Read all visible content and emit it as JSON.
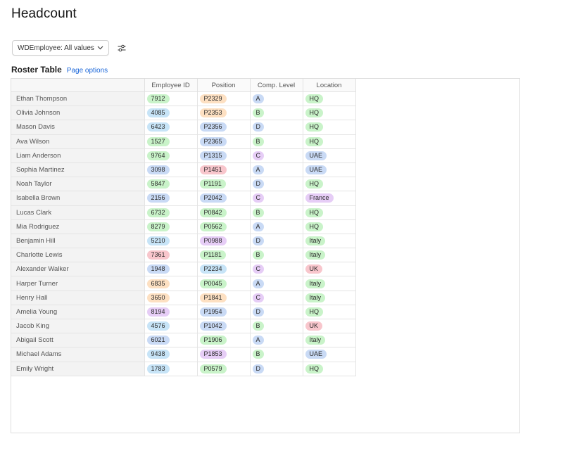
{
  "page": {
    "title": "Headcount"
  },
  "filter": {
    "label": "WDEmployee: All values",
    "settings_icon": "sliders-icon"
  },
  "section": {
    "title": "Roster Table",
    "options_link": "Page options"
  },
  "colors": {
    "green": "#c9f3c9",
    "blue": "#c9daf5",
    "orange": "#fde0c2",
    "pink": "#f8c6cc",
    "purple": "#e6cdf6",
    "skyblue": "#c7e4f7",
    "link": "#1a66d9"
  },
  "table": {
    "headers": [
      "",
      "Employee ID",
      "Position",
      "Comp. Level",
      "Location"
    ],
    "rows": [
      {
        "name": "Ethan Thompson",
        "id": "7912",
        "id_color": "green",
        "pos": "P2329",
        "pos_color": "orange",
        "comp": "A",
        "comp_color": "blue",
        "loc": "HQ",
        "loc_color": "green"
      },
      {
        "name": "Olivia Johnson",
        "id": "4085",
        "id_color": "skyblue",
        "pos": "P2353",
        "pos_color": "orange",
        "comp": "B",
        "comp_color": "green",
        "loc": "HQ",
        "loc_color": "green"
      },
      {
        "name": "Mason Davis",
        "id": "6423",
        "id_color": "skyblue",
        "pos": "P2356",
        "pos_color": "blue",
        "comp": "D",
        "comp_color": "blue",
        "loc": "HQ",
        "loc_color": "green"
      },
      {
        "name": "Ava Wilson",
        "id": "1527",
        "id_color": "green",
        "pos": "P2365",
        "pos_color": "blue",
        "comp": "B",
        "comp_color": "green",
        "loc": "HQ",
        "loc_color": "green"
      },
      {
        "name": "Liam Anderson",
        "id": "9764",
        "id_color": "green",
        "pos": "P1315",
        "pos_color": "blue",
        "comp": "C",
        "comp_color": "purple",
        "loc": "UAE",
        "loc_color": "blue"
      },
      {
        "name": "Sophia Martinez",
        "id": "3098",
        "id_color": "blue",
        "pos": "P1451",
        "pos_color": "pink",
        "comp": "A",
        "comp_color": "blue",
        "loc": "UAE",
        "loc_color": "blue"
      },
      {
        "name": "Noah Taylor",
        "id": "5847",
        "id_color": "green",
        "pos": "P1191",
        "pos_color": "green",
        "comp": "D",
        "comp_color": "blue",
        "loc": "HQ",
        "loc_color": "green"
      },
      {
        "name": "Isabella Brown",
        "id": "2156",
        "id_color": "blue",
        "pos": "P2042",
        "pos_color": "blue",
        "comp": "C",
        "comp_color": "purple",
        "loc": "France",
        "loc_color": "purple"
      },
      {
        "name": "Lucas Clark",
        "id": "6732",
        "id_color": "green",
        "pos": "P0842",
        "pos_color": "green",
        "comp": "B",
        "comp_color": "green",
        "loc": "HQ",
        "loc_color": "green"
      },
      {
        "name": "Mia Rodriguez",
        "id": "8279",
        "id_color": "green",
        "pos": "P0562",
        "pos_color": "green",
        "comp": "A",
        "comp_color": "blue",
        "loc": "HQ",
        "loc_color": "green"
      },
      {
        "name": "Benjamin Hill",
        "id": "5210",
        "id_color": "skyblue",
        "pos": "P0988",
        "pos_color": "purple",
        "comp": "D",
        "comp_color": "blue",
        "loc": "Italy",
        "loc_color": "green"
      },
      {
        "name": "Charlotte Lewis",
        "id": "7361",
        "id_color": "pink",
        "pos": "P1181",
        "pos_color": "green",
        "comp": "B",
        "comp_color": "green",
        "loc": "Italy",
        "loc_color": "green"
      },
      {
        "name": "Alexander Walker",
        "id": "1948",
        "id_color": "blue",
        "pos": "P2234",
        "pos_color": "skyblue",
        "comp": "C",
        "comp_color": "purple",
        "loc": "UK",
        "loc_color": "pink"
      },
      {
        "name": "Harper Turner",
        "id": "6835",
        "id_color": "orange",
        "pos": "P0045",
        "pos_color": "green",
        "comp": "A",
        "comp_color": "blue",
        "loc": "Italy",
        "loc_color": "green"
      },
      {
        "name": "Henry Hall",
        "id": "3650",
        "id_color": "orange",
        "pos": "P1841",
        "pos_color": "orange",
        "comp": "C",
        "comp_color": "purple",
        "loc": "Italy",
        "loc_color": "green"
      },
      {
        "name": "Amelia Young",
        "id": "8194",
        "id_color": "purple",
        "pos": "P1954",
        "pos_color": "blue",
        "comp": "D",
        "comp_color": "blue",
        "loc": "HQ",
        "loc_color": "green"
      },
      {
        "name": "Jacob King",
        "id": "4576",
        "id_color": "skyblue",
        "pos": "P1042",
        "pos_color": "blue",
        "comp": "B",
        "comp_color": "green",
        "loc": "UK",
        "loc_color": "pink"
      },
      {
        "name": "Abigail Scott",
        "id": "6021",
        "id_color": "blue",
        "pos": "P1906",
        "pos_color": "green",
        "comp": "A",
        "comp_color": "blue",
        "loc": "Italy",
        "loc_color": "green"
      },
      {
        "name": "Michael Adams",
        "id": "9438",
        "id_color": "skyblue",
        "pos": "P1853",
        "pos_color": "purple",
        "comp": "B",
        "comp_color": "green",
        "loc": "UAE",
        "loc_color": "blue"
      },
      {
        "name": "Emily Wright",
        "id": "1783",
        "id_color": "skyblue",
        "pos": "P0579",
        "pos_color": "green",
        "comp": "D",
        "comp_color": "blue",
        "loc": "HQ",
        "loc_color": "green"
      }
    ]
  }
}
